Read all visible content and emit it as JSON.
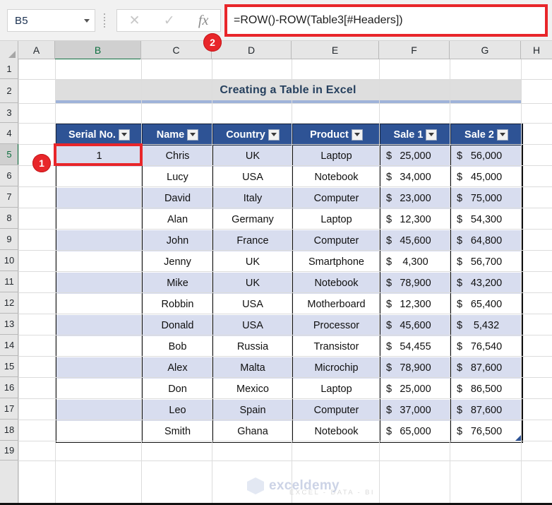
{
  "formula_bar": {
    "name_box_value": "B5",
    "cancel_icon": "x-icon",
    "confirm_icon": "check-icon",
    "function_icon": "fx-icon",
    "formula_text": "=ROW()-ROW(Table3[#Headers])",
    "highlight_color": "#e8262a"
  },
  "grid": {
    "column_headers": [
      "A",
      "B",
      "C",
      "D",
      "E",
      "F",
      "G",
      "H"
    ],
    "selected_column": "B",
    "row_headers": [
      "1",
      "2",
      "3",
      "4",
      "5",
      "6",
      "7",
      "8",
      "9",
      "10",
      "11",
      "12",
      "13",
      "14",
      "15",
      "16",
      "17",
      "18",
      "19"
    ],
    "selected_row": "5",
    "selected_cell": "B5"
  },
  "sheet": {
    "title": "Creating a Table in Excel",
    "title_range": "B2:G2",
    "title_bg": "#dedede",
    "title_underline": "#9fb3d9"
  },
  "table": {
    "name": "Table3",
    "header_bg": "#2e5395",
    "band_color": "#d8ddef",
    "headers": [
      "Serial No.",
      "Name",
      "Country",
      "Product",
      "Sale 1",
      "Sale 2"
    ],
    "filter_icon": "filter-dropdown-icon",
    "rows": [
      {
        "serial": "1",
        "name": "Chris",
        "country": "UK",
        "product": "Laptop",
        "sale1": "25,000",
        "sale2": "56,000"
      },
      {
        "serial": "",
        "name": "Lucy",
        "country": "USA",
        "product": "Notebook",
        "sale1": "34,000",
        "sale2": "45,000"
      },
      {
        "serial": "",
        "name": "David",
        "country": "Italy",
        "product": "Computer",
        "sale1": "23,000",
        "sale2": "75,000"
      },
      {
        "serial": "",
        "name": "Alan",
        "country": "Germany",
        "product": "Laptop",
        "sale1": "12,300",
        "sale2": "54,300"
      },
      {
        "serial": "",
        "name": "John",
        "country": "France",
        "product": "Computer",
        "sale1": "45,600",
        "sale2": "64,800"
      },
      {
        "serial": "",
        "name": "Jenny",
        "country": "UK",
        "product": "Smartphone",
        "sale1": "4,300",
        "sale2": "56,700"
      },
      {
        "serial": "",
        "name": "Mike",
        "country": "UK",
        "product": "Notebook",
        "sale1": "78,900",
        "sale2": "43,200"
      },
      {
        "serial": "",
        "name": "Robbin",
        "country": "USA",
        "product": "Motherboard",
        "sale1": "12,300",
        "sale2": "65,400"
      },
      {
        "serial": "",
        "name": "Donald",
        "country": "USA",
        "product": "Processor",
        "sale1": "45,600",
        "sale2": "5,432"
      },
      {
        "serial": "",
        "name": "Bob",
        "country": "Russia",
        "product": "Transistor",
        "sale1": "54,455",
        "sale2": "76,540"
      },
      {
        "serial": "",
        "name": "Alex",
        "country": "Malta",
        "product": "Microchip",
        "sale1": "78,900",
        "sale2": "87,600"
      },
      {
        "serial": "",
        "name": "Don",
        "country": "Mexico",
        "product": "Laptop",
        "sale1": "25,000",
        "sale2": "86,500"
      },
      {
        "serial": "",
        "name": "Leo",
        "country": "Spain",
        "product": "Computer",
        "sale1": "37,000",
        "sale2": "87,600"
      },
      {
        "serial": "",
        "name": "Smith",
        "country": "Ghana",
        "product": "Notebook",
        "sale1": "65,000",
        "sale2": "76,500"
      }
    ],
    "currency_symbol": "$"
  },
  "callouts": [
    {
      "label": "1"
    },
    {
      "label": "2"
    }
  ],
  "watermark": {
    "name": "exceldemy",
    "subtitle": "EXCEL - DATA - BI",
    "logo_icon": "hexagon-logo-icon"
  }
}
